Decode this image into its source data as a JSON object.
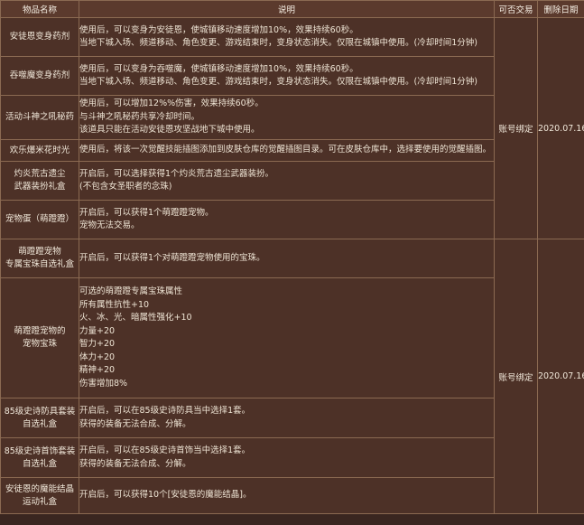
{
  "headers": {
    "name": "物品名称",
    "desc": "说明",
    "trade": "可否交易",
    "date": "删除日期"
  },
  "groups": [
    {
      "trade": "账号绑定",
      "date": "2020.07.16"
    },
    {
      "trade": "账号绑定",
      "date": "2020.07.16"
    }
  ],
  "rows": [
    {
      "name": [
        "安徒恩变身药剂"
      ],
      "desc": [
        "使用后，可以变身为安徒恩，使城镇移动速度增加10%，效果持续60秒。",
        "当地下城入场、频道移动、角色变更、游戏结束时，变身状态消失。仅限在城镇中使用。(冷却时间1分钟)"
      ]
    },
    {
      "name": [
        "吞噬魔变身药剂"
      ],
      "desc": [
        "使用后，可以变身为吞噬魔，使城镇移动速度增加10%，效果持续60秒。",
        "当地下城入场、频道移动、角色变更、游戏结束时，变身状态消失。仅限在城镇中使用。(冷却时间1分钟)"
      ]
    },
    {
      "name": [
        "活动斗神之吼秘药"
      ],
      "desc": [
        "使用后，可以增加12%%伤害，效果持续60秒。",
        "与斗神之吼秘药共享冷却时间。",
        "该道具只能在活动安徒恩攻坚战地下城中使用。"
      ]
    },
    {
      "name": [
        "欢乐爆米花时光"
      ],
      "desc": [
        "使用后，将该一次觉醒技能插图添加到皮肤仓库的觉醒插图目录。可在皮肤仓库中，选择要使用的觉醒插图。"
      ]
    },
    {
      "name": [
        "灼炎荒古遗尘",
        "武器装扮礼盒"
      ],
      "desc": [
        "开启后，可以选择获得1个灼炎荒古遗尘武器装扮。",
        "(不包含女圣职者的念珠)"
      ]
    },
    {
      "name": [
        "宠物蛋（萌蹬蹬）"
      ],
      "desc": [
        "开启后，可以获得1个萌蹬蹬宠物。",
        "宠物无法交易。"
      ]
    },
    {
      "name": [
        "萌蹬蹬宠物",
        "专属宝珠自选礼盒"
      ],
      "desc": [
        "开启后，可以获得1个对萌蹬蹬宠物使用的宝珠。"
      ]
    },
    {
      "name": [
        "萌蹬蹬宠物的",
        "宠物宝珠"
      ],
      "desc": [
        "可选的萌蹬蹬专属宝珠属性",
        "所有属性抗性+10",
        "火、冰、光、暗属性强化+10",
        "力量+20",
        "智力+20",
        "体力+20",
        "精神+20",
        "伤害增加8%"
      ]
    },
    {
      "name": [
        "85级史诗防具套装",
        "自选礼盒"
      ],
      "desc": [
        "开启后，可以在85级史诗防具当中选择1套。",
        "获得的装备无法合成、分解。"
      ]
    },
    {
      "name": [
        "85级史诗首饰套装",
        "自选礼盒"
      ],
      "desc": [
        "开启后，可以在85级史诗首饰当中选择1套。",
        "获得的装备无法合成、分解。"
      ]
    },
    {
      "name": [
        "安徒恩的魔能结晶",
        "运动礼盒"
      ],
      "desc": [
        "开启后，可以获得10个[安徒恩的魔能结晶]。"
      ]
    }
  ]
}
